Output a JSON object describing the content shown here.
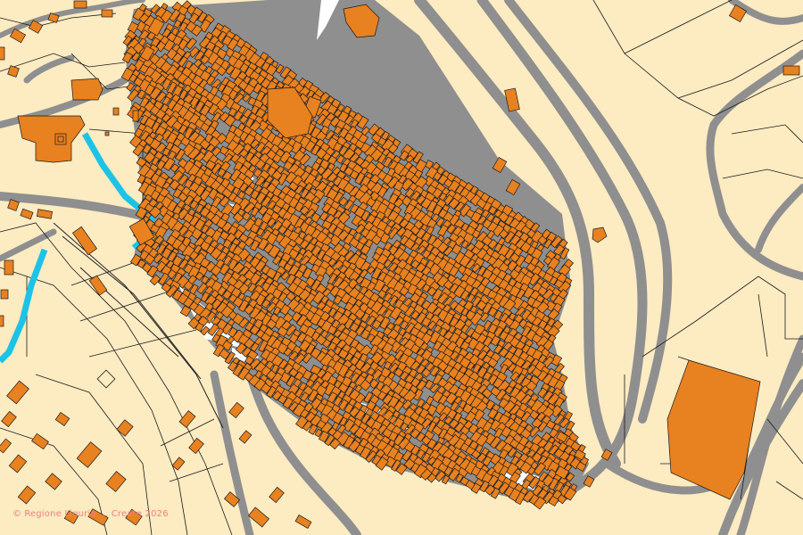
{
  "map": {
    "colors": {
      "background": "#fdebc2",
      "road": "#8f8f8f",
      "building": "#e8811f",
      "building_outline": "#1a1a1a",
      "water": "#1cc3e6",
      "attribution": "#f08080"
    },
    "attribution": {
      "symbol": "©",
      "text": "Regione Liguria ... Create 2026"
    }
  }
}
